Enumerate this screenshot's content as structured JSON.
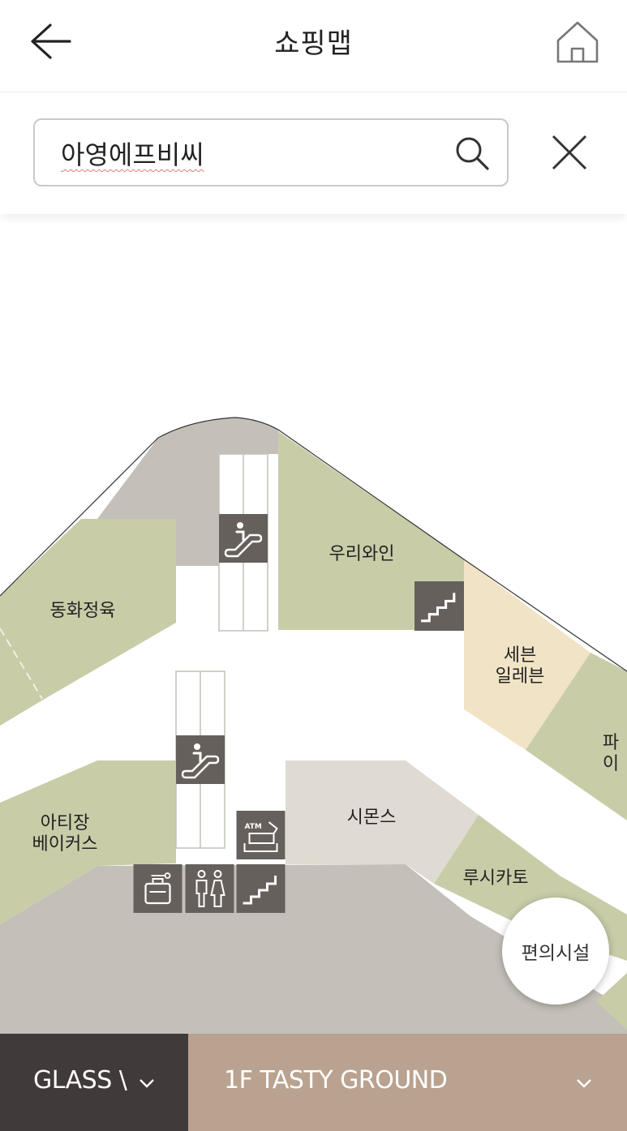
{
  "header": {
    "title": "쇼핑맵",
    "back_icon": "arrow-left-icon",
    "home_icon": "home-icon"
  },
  "search": {
    "value": "아영에프비씨",
    "search_icon": "search-icon",
    "clear_icon": "close-icon"
  },
  "map": {
    "stores": [
      {
        "name": "우리와인",
        "color": "#c8cda8"
      },
      {
        "name": "동화정육",
        "color": "#c8cda8"
      },
      {
        "name": "세븐\n일레븐",
        "color": "#f1e4c6"
      },
      {
        "name": "파이",
        "color": "#c8cda8"
      },
      {
        "name": "아티장\n베이커스",
        "color": "#c8cda8"
      },
      {
        "name": "시몬스",
        "color": "#e0dbd2"
      },
      {
        "name": "루시카토",
        "color": "#c8cda8"
      }
    ],
    "facilities": [
      {
        "icon": "escalator-icon"
      },
      {
        "icon": "escalator-icon"
      },
      {
        "icon": "stairs-icon"
      },
      {
        "icon": "stairs-icon"
      },
      {
        "icon": "atm-icon",
        "text": "ATM"
      },
      {
        "icon": "locker-icon"
      },
      {
        "icon": "restroom-icon"
      }
    ],
    "colors": {
      "store": "#c8cda8",
      "convenience": "#f1e4c6",
      "common": "#c4c0b9",
      "icon_bg": "#66605d"
    }
  },
  "facility_button": {
    "label": "편의시설"
  },
  "bottom_bar": {
    "building": "GLASS \\",
    "floor": "1F TASTY GROUND",
    "chevron_icon": "chevron-down-icon"
  }
}
